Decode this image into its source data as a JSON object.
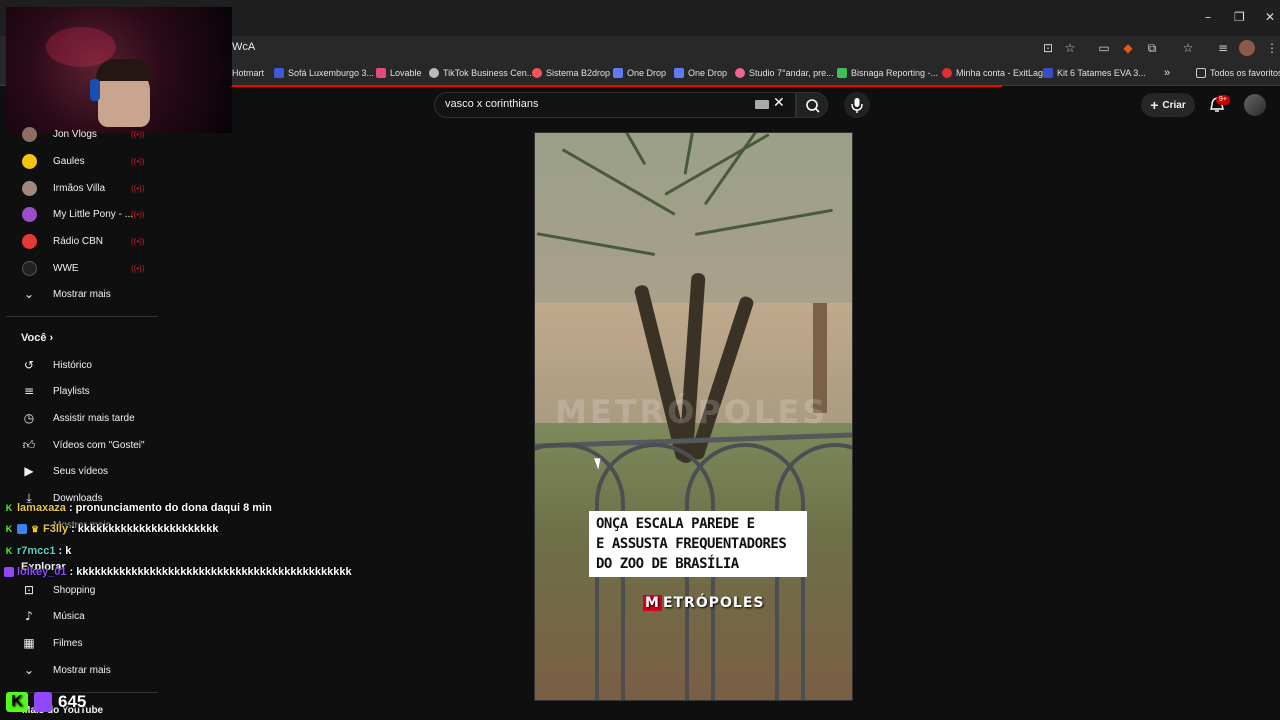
{
  "browser": {
    "url_fragment": "WcA",
    "bookmarks": [
      {
        "label": "Hotmart",
        "color": ""
      },
      {
        "label": "Sofá Luxemburgo 3...",
        "color": "#3b5bdb"
      },
      {
        "label": "Lovable",
        "color": "#e64980"
      },
      {
        "label": "TikTok Business Cen...",
        "color": "#bbbbbb"
      },
      {
        "label": "Sistema B2drop",
        "color": "#fa5252"
      },
      {
        "label": "One Drop",
        "color": "#5c7cfa"
      },
      {
        "label": "One Drop",
        "color": "#5c7cfa"
      },
      {
        "label": "Studio 7°andar, pre...",
        "color": "#f06595"
      },
      {
        "label": "Bisnaga Reporting -...",
        "color": "#40c057"
      },
      {
        "label": "Minha conta - ExitLag",
        "color": "#e03131"
      },
      {
        "label": "Kit 6 Tatames EVA 3...",
        "color": "#364fc7"
      }
    ],
    "all_favorites": "Todos os favoritos",
    "overflow": "»"
  },
  "youtube": {
    "search_value": "vasco x corinthians",
    "create_label": "Criar",
    "notifications_badge": "9+",
    "subscriptions": [
      {
        "label": "Jon Vlogs",
        "color": "#8d6e63"
      },
      {
        "label": "Gaules",
        "color": "#f1c40f"
      },
      {
        "label": "Irmãos Villa",
        "color": "#a1887f"
      },
      {
        "label": "My Little Pony - ...",
        "color": "#9c4dcc"
      },
      {
        "label": "Rádio CBN",
        "color": "#e53935"
      },
      {
        "label": "WWE",
        "color": "#222222"
      }
    ],
    "show_more": "Mostrar mais",
    "you_section": "Você",
    "you_items": [
      {
        "label": "Histórico",
        "icon": "history-icon"
      },
      {
        "label": "Playlists",
        "icon": "playlists-icon"
      },
      {
        "label": "Assistir mais tarde",
        "icon": "clock-icon"
      },
      {
        "label": "Vídeos com \"Gostei\"",
        "icon": "thumbs-up-icon"
      },
      {
        "label": "Seus vídeos",
        "icon": "your-videos-icon"
      },
      {
        "label": "Downloads",
        "icon": "download-icon"
      }
    ],
    "you_show_more": "Mostrar mais",
    "explore_title": "Explorar",
    "explore_items": [
      {
        "label": "Shopping",
        "icon": "shopping-bag-icon"
      },
      {
        "label": "Música",
        "icon": "music-note-icon"
      },
      {
        "label": "Filmes",
        "icon": "film-icon"
      }
    ],
    "explore_show_more": "Mostrar mais",
    "more_from_youtube": "Mais do YouTube"
  },
  "video": {
    "watermark": "METRÓPOLES",
    "caption_lines": [
      "ONÇA ESCALA PAREDE E",
      "E ASSUSTA FREQUENTADORES",
      "DO ZOO DE BRASÍLIA"
    ],
    "brand_m": "M",
    "brand_rest": "ETRÓPOLES"
  },
  "chat": [
    {
      "user": "lamaxaza",
      "message": ": pronunciamento do dona daqui 8 min",
      "user_color": "#e8c84a"
    },
    {
      "user": "F3lly",
      "message": ": kkkkkkkkkkkkkkkkkkkkkkk",
      "user_color": "#e8c84a"
    },
    {
      "user": "r7mcc1",
      "message": ": k",
      "user_color": "#5fd1c1"
    },
    {
      "user": "lolkey_01",
      "message": ": kkkkkkkkkkkkkkkkkkkkkkkkkkkkkkkkkkkkkkkkkkkkk",
      "user_color": "#9146ff"
    }
  ],
  "viewer_count": "645"
}
